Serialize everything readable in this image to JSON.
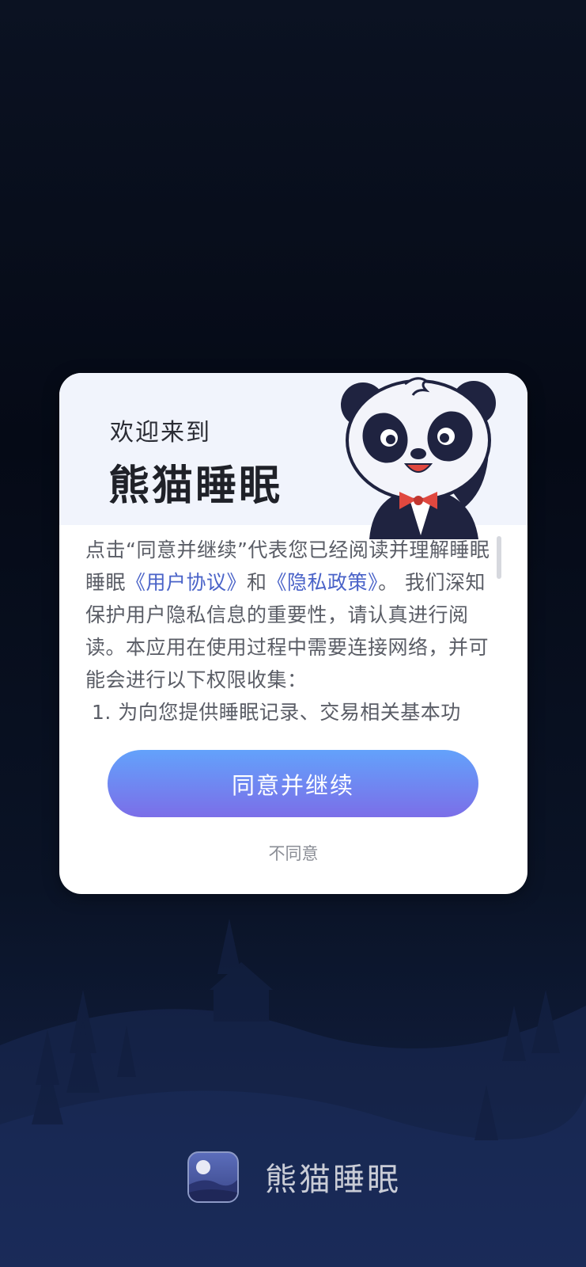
{
  "dialog": {
    "welcome": "欢迎来到",
    "app_title": "熊猫睡眠",
    "body": {
      "intro_before": "点击“同意并继续”代表您已经阅读并理解睡眠睡眠",
      "user_agreement_link": "《用户协议》",
      "and": "和",
      "privacy_policy_link": "《隐私政策》",
      "intro_after": "。 我们深知保护用户隐私信息的重要性，请认真进行阅读。本应用在使用过程中需要连接网络，并可能会进行以下权限收集：",
      "list_item_1": "1. 为向您提供睡眠记录、交易相关基本功"
    },
    "agree_label": "同意并继续",
    "disagree_label": "不同意"
  },
  "brand": {
    "name": "熊猫睡眠"
  },
  "colors": {
    "accent_gradient_start": "#63a2fb",
    "accent_gradient_end": "#7b6ee8",
    "link": "#4a63c8",
    "background": "#050a16"
  }
}
